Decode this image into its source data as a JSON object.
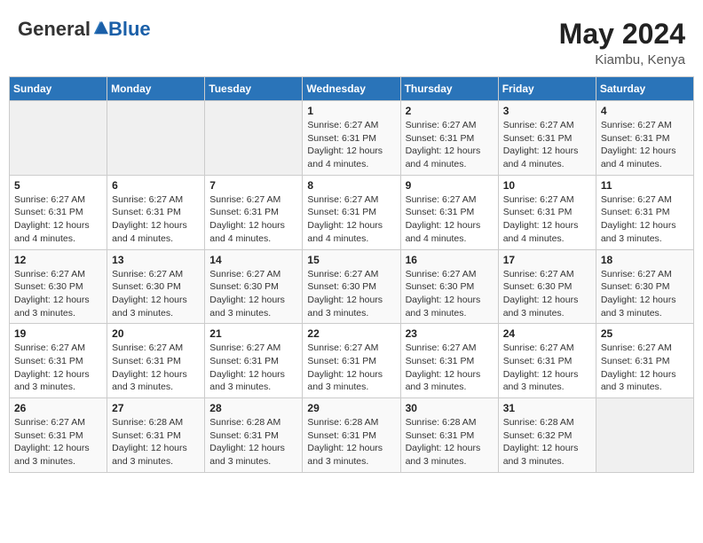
{
  "logo": {
    "part1": "General",
    "part2": "Blue"
  },
  "title": {
    "month_year": "May 2024",
    "location": "Kiambu, Kenya"
  },
  "header_days": [
    "Sunday",
    "Monday",
    "Tuesday",
    "Wednesday",
    "Thursday",
    "Friday",
    "Saturday"
  ],
  "weeks": [
    [
      {
        "day": "",
        "info": ""
      },
      {
        "day": "",
        "info": ""
      },
      {
        "day": "",
        "info": ""
      },
      {
        "day": "1",
        "info": "Sunrise: 6:27 AM\nSunset: 6:31 PM\nDaylight: 12 hours and 4 minutes."
      },
      {
        "day": "2",
        "info": "Sunrise: 6:27 AM\nSunset: 6:31 PM\nDaylight: 12 hours and 4 minutes."
      },
      {
        "day": "3",
        "info": "Sunrise: 6:27 AM\nSunset: 6:31 PM\nDaylight: 12 hours and 4 minutes."
      },
      {
        "day": "4",
        "info": "Sunrise: 6:27 AM\nSunset: 6:31 PM\nDaylight: 12 hours and 4 minutes."
      }
    ],
    [
      {
        "day": "5",
        "info": "Sunrise: 6:27 AM\nSunset: 6:31 PM\nDaylight: 12 hours and 4 minutes."
      },
      {
        "day": "6",
        "info": "Sunrise: 6:27 AM\nSunset: 6:31 PM\nDaylight: 12 hours and 4 minutes."
      },
      {
        "day": "7",
        "info": "Sunrise: 6:27 AM\nSunset: 6:31 PM\nDaylight: 12 hours and 4 minutes."
      },
      {
        "day": "8",
        "info": "Sunrise: 6:27 AM\nSunset: 6:31 PM\nDaylight: 12 hours and 4 minutes."
      },
      {
        "day": "9",
        "info": "Sunrise: 6:27 AM\nSunset: 6:31 PM\nDaylight: 12 hours and 4 minutes."
      },
      {
        "day": "10",
        "info": "Sunrise: 6:27 AM\nSunset: 6:31 PM\nDaylight: 12 hours and 4 minutes."
      },
      {
        "day": "11",
        "info": "Sunrise: 6:27 AM\nSunset: 6:31 PM\nDaylight: 12 hours and 3 minutes."
      }
    ],
    [
      {
        "day": "12",
        "info": "Sunrise: 6:27 AM\nSunset: 6:30 PM\nDaylight: 12 hours and 3 minutes."
      },
      {
        "day": "13",
        "info": "Sunrise: 6:27 AM\nSunset: 6:30 PM\nDaylight: 12 hours and 3 minutes."
      },
      {
        "day": "14",
        "info": "Sunrise: 6:27 AM\nSunset: 6:30 PM\nDaylight: 12 hours and 3 minutes."
      },
      {
        "day": "15",
        "info": "Sunrise: 6:27 AM\nSunset: 6:30 PM\nDaylight: 12 hours and 3 minutes."
      },
      {
        "day": "16",
        "info": "Sunrise: 6:27 AM\nSunset: 6:30 PM\nDaylight: 12 hours and 3 minutes."
      },
      {
        "day": "17",
        "info": "Sunrise: 6:27 AM\nSunset: 6:30 PM\nDaylight: 12 hours and 3 minutes."
      },
      {
        "day": "18",
        "info": "Sunrise: 6:27 AM\nSunset: 6:30 PM\nDaylight: 12 hours and 3 minutes."
      }
    ],
    [
      {
        "day": "19",
        "info": "Sunrise: 6:27 AM\nSunset: 6:31 PM\nDaylight: 12 hours and 3 minutes."
      },
      {
        "day": "20",
        "info": "Sunrise: 6:27 AM\nSunset: 6:31 PM\nDaylight: 12 hours and 3 minutes."
      },
      {
        "day": "21",
        "info": "Sunrise: 6:27 AM\nSunset: 6:31 PM\nDaylight: 12 hours and 3 minutes."
      },
      {
        "day": "22",
        "info": "Sunrise: 6:27 AM\nSunset: 6:31 PM\nDaylight: 12 hours and 3 minutes."
      },
      {
        "day": "23",
        "info": "Sunrise: 6:27 AM\nSunset: 6:31 PM\nDaylight: 12 hours and 3 minutes."
      },
      {
        "day": "24",
        "info": "Sunrise: 6:27 AM\nSunset: 6:31 PM\nDaylight: 12 hours and 3 minutes."
      },
      {
        "day": "25",
        "info": "Sunrise: 6:27 AM\nSunset: 6:31 PM\nDaylight: 12 hours and 3 minutes."
      }
    ],
    [
      {
        "day": "26",
        "info": "Sunrise: 6:27 AM\nSunset: 6:31 PM\nDaylight: 12 hours and 3 minutes."
      },
      {
        "day": "27",
        "info": "Sunrise: 6:28 AM\nSunset: 6:31 PM\nDaylight: 12 hours and 3 minutes."
      },
      {
        "day": "28",
        "info": "Sunrise: 6:28 AM\nSunset: 6:31 PM\nDaylight: 12 hours and 3 minutes."
      },
      {
        "day": "29",
        "info": "Sunrise: 6:28 AM\nSunset: 6:31 PM\nDaylight: 12 hours and 3 minutes."
      },
      {
        "day": "30",
        "info": "Sunrise: 6:28 AM\nSunset: 6:31 PM\nDaylight: 12 hours and 3 minutes."
      },
      {
        "day": "31",
        "info": "Sunrise: 6:28 AM\nSunset: 6:32 PM\nDaylight: 12 hours and 3 minutes."
      },
      {
        "day": "",
        "info": ""
      }
    ]
  ]
}
